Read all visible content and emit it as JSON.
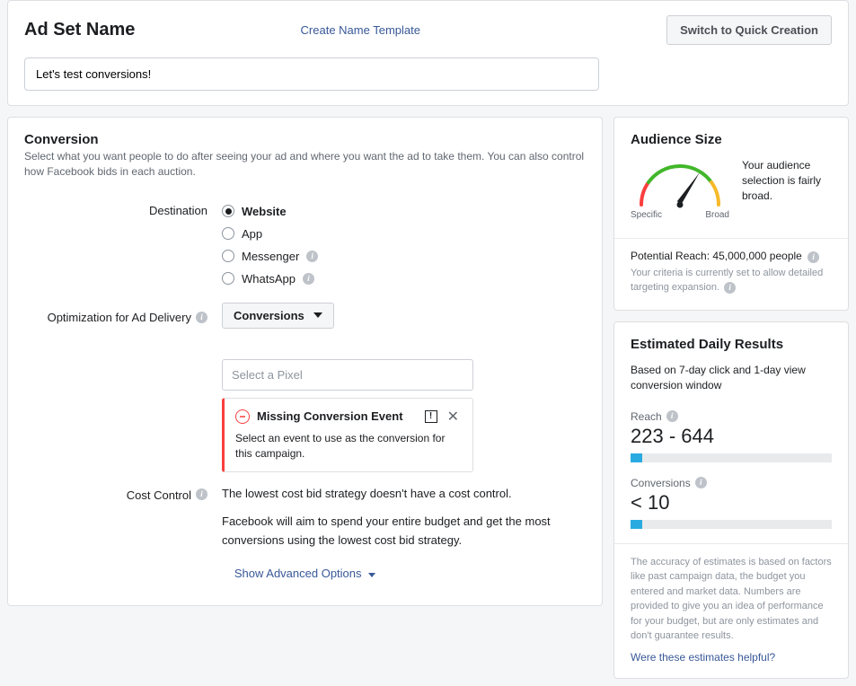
{
  "header": {
    "title": "Ad Set Name",
    "create_template_link": "Create Name Template",
    "switch_button": "Switch to Quick Creation",
    "name_input_value": "Let's test conversions!"
  },
  "conversion": {
    "title": "Conversion",
    "description": "Select what you want people to do after seeing your ad and where you want the ad to take them. You can also control how Facebook bids in each auction.",
    "destination_label": "Destination",
    "destinations": [
      {
        "label": "Website",
        "checked": true,
        "info": false
      },
      {
        "label": "App",
        "checked": false,
        "info": false
      },
      {
        "label": "Messenger",
        "checked": false,
        "info": true
      },
      {
        "label": "WhatsApp",
        "checked": false,
        "info": true
      }
    ],
    "optimization_label": "Optimization for Ad Delivery",
    "optimization_value": "Conversions",
    "pixel_placeholder": "Select a Pixel",
    "error": {
      "title": "Missing Conversion Event",
      "body": "Select an event to use as the conversion for this campaign."
    },
    "cost_control_label": "Cost Control",
    "cost_control_line1": "The lowest cost bid strategy doesn't have a cost control.",
    "cost_control_line2": "Facebook will aim to spend your entire budget and get the most conversions using the lowest cost bid strategy.",
    "advanced_link": "Show Advanced Options"
  },
  "audience": {
    "title": "Audience Size",
    "gauge_text": "Your audience selection is fairly broad.",
    "gauge_left": "Specific",
    "gauge_right": "Broad",
    "reach_label": "Potential Reach:",
    "reach_value": "45,000,000 people",
    "disclaimer": "Your criteria is currently set to allow detailed targeting expansion."
  },
  "estimates": {
    "title": "Estimated Daily Results",
    "subtitle": "Based on 7-day click and 1-day view conversion window",
    "reach_label": "Reach",
    "reach_value": "223 - 644",
    "conversions_label": "Conversions",
    "conversions_value": "< 10",
    "accuracy_note": "The accuracy of estimates is based on factors like past campaign data, the budget you entered and market data. Numbers are provided to give you an idea of performance for your budget, but are only estimates and don't guarantee results.",
    "helpful_link": "Were these estimates helpful?"
  }
}
